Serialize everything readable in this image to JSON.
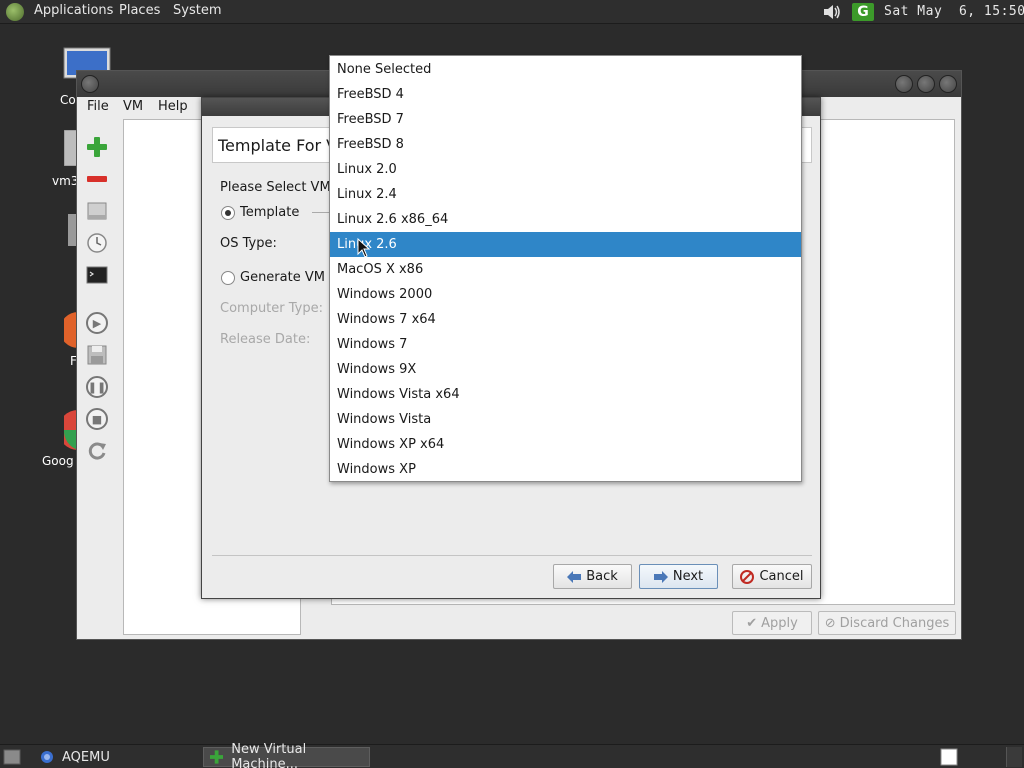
{
  "top_panel": {
    "menus": [
      "Applications",
      "Places",
      "System"
    ],
    "clock": "Sat May  6, 15:50",
    "tray_icons": [
      "volume-icon",
      "g-update-icon"
    ]
  },
  "desktop": {
    "icons": [
      {
        "label": "Co",
        "icon": "computer-icon"
      },
      {
        "label": "vm3",
        "icon": "drive-icon"
      },
      {
        "label": "",
        "icon": "trash-icon"
      },
      {
        "label": "F",
        "icon": "firefox-icon"
      },
      {
        "label": "Goog",
        "icon": "chrome-icon"
      }
    ]
  },
  "main_window": {
    "menu": [
      "File",
      "VM",
      "Help"
    ],
    "toolbar": [
      "add-vm-icon",
      "remove-vm-icon",
      "vm-disk-icon",
      "clock-icon",
      "terminal-icon",
      "play-icon",
      "save-icon",
      "pause-icon",
      "stop-icon",
      "reload-icon"
    ],
    "apply_label": "Apply",
    "discard_label": "Discard Changes"
  },
  "dialog": {
    "header": "Template For V",
    "select_label": "Please Select VM",
    "template_label": "Template",
    "os_type_label": "OS Type:",
    "generate_label": "Generate VM",
    "computer_type_label": "Computer Type:",
    "release_date_label": "Release Date:",
    "back_label": "Back",
    "next_label": "Next",
    "cancel_label": "Cancel"
  },
  "os_dropdown": {
    "items": [
      "None Selected",
      "FreeBSD 4",
      "FreeBSD 7",
      "FreeBSD 8",
      "Linux 2.0",
      "Linux 2.4",
      "Linux 2.6 x86_64",
      "Linux 2.6",
      "MacOS X x86",
      "Windows 2000",
      "Windows 7 x64",
      "Windows 7",
      "Windows 9X",
      "Windows Vista x64",
      "Windows Vista",
      "Windows XP x64",
      "Windows XP"
    ],
    "selected": "Linux 2.6"
  },
  "taskbar": {
    "entries": [
      "AQEMU",
      "New Virtual Machine..."
    ]
  },
  "colors": {
    "selection": "#2f86c8",
    "panel": "#2e2e2e",
    "desktop": "#2b2b2b"
  }
}
